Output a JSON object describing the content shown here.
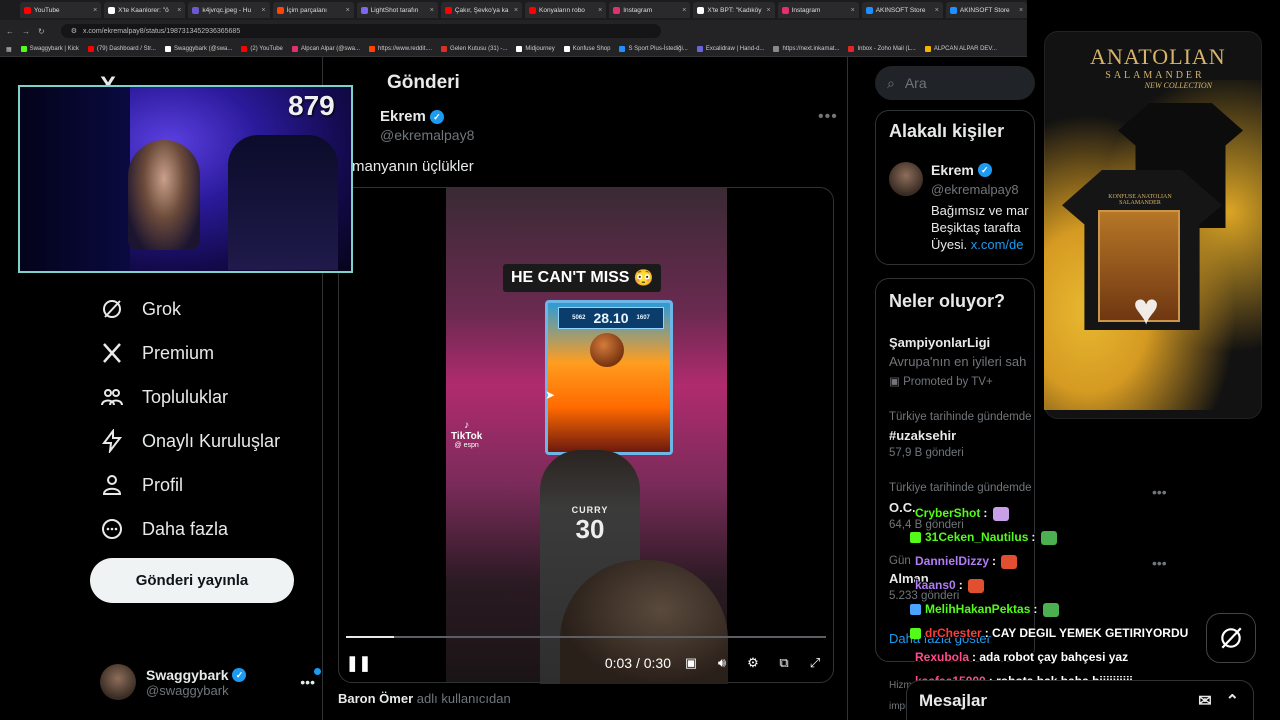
{
  "browser": {
    "tabs": [
      {
        "label": "YouTube",
        "color": "#ff0000"
      },
      {
        "label": "X'te Kaanlorer: \"ö",
        "color": "#ffffff"
      },
      {
        "label": "k4jvrqc.jpeg - Hu",
        "color": "#6a5acd"
      },
      {
        "label": "İçim parçalanı",
        "color": "#ff4500"
      },
      {
        "label": "LightShot tarafın",
        "color": "#7b68ee"
      },
      {
        "label": "Çakır, Şevko'ya ka",
        "color": "#ff0000"
      },
      {
        "label": "Konyaların robo",
        "color": "#ff0000"
      },
      {
        "label": "Instagram",
        "color": "#e1306c"
      },
      {
        "label": "X'te BPT: \"Kadıköy",
        "color": "#ffffff"
      },
      {
        "label": "Instagram",
        "color": "#e1306c"
      },
      {
        "label": "AKINSOFT Store",
        "color": "#1e90ff"
      },
      {
        "label": "AKINSOFT Store",
        "color": "#1e90ff"
      }
    ],
    "url": "x.com/ekremalpay8/status/1987313452936365685",
    "bookmarks": [
      {
        "label": "Swaggybark | Kick",
        "color": "#53fc18"
      },
      {
        "label": "(79) Dashboard / Str...",
        "color": "#ff0000"
      },
      {
        "label": "Swaggybark (@swa...",
        "color": "#ffffff"
      },
      {
        "label": "(2) YouTube",
        "color": "#ff0000"
      },
      {
        "label": "Alpcan Alpar (@swa...",
        "color": "#e1306c"
      },
      {
        "label": "https://www.reddit....",
        "color": "#ff4500"
      },
      {
        "label": "Gelen Kutusu (31) -...",
        "color": "#d93025"
      },
      {
        "label": "Midjourney",
        "color": "#ffffff"
      },
      {
        "label": "Konfuse Shop",
        "color": "#ffffff"
      },
      {
        "label": "S Sport Plus-İstediği...",
        "color": "#1e90ff"
      },
      {
        "label": "Excalidraw | Hand-d...",
        "color": "#6965db"
      },
      {
        "label": "https://next.inkamat...",
        "color": "#888888"
      },
      {
        "label": "Inbox - Zoho Mail (L...",
        "color": "#e42527"
      },
      {
        "label": "ALPCAN ALPAR DEV...",
        "color": "#f4b400"
      }
    ]
  },
  "nav": {
    "items": [
      {
        "label": "Grok",
        "icon": "grok-icon"
      },
      {
        "label": "Premium",
        "icon": "x-logo-icon"
      },
      {
        "label": "Topluluklar",
        "icon": "communities-icon"
      },
      {
        "label": "Onaylı Kuruluşlar",
        "icon": "lightning-icon"
      },
      {
        "label": "Profil",
        "icon": "person-icon"
      },
      {
        "label": "Daha fazla",
        "icon": "more-circle-icon"
      }
    ],
    "post_button": "Gönderi yayınla",
    "account": {
      "name": "Swaggybark",
      "handle": "@swaggybark"
    }
  },
  "post": {
    "header": "Gönderi",
    "author": "Ekrem",
    "handle": "@ekremalpay8",
    "text": "manyanın üçlükler",
    "video": {
      "caption": "HE CAN'T MISS",
      "caption_emoji": "😳",
      "arcade_score": "28.10",
      "arcade_left": "5062",
      "arcade_right": "1607",
      "jersey_name": "CURRY",
      "jersey_number": "30",
      "watermark": "TikTok",
      "watermark_handle": "@ espn",
      "time": "0:03 / 0:30",
      "progress": 0.1
    },
    "reply_user": "Baron Ömer",
    "reply_suffix": "adlı kullanıcıdan"
  },
  "sidebar": {
    "search_placeholder": "Ara",
    "related_title": "Alakalı kişiler",
    "related": {
      "name": "Ekrem",
      "handle": "@ekremalpay8",
      "bio_line1": "Bağımsız ve mar",
      "bio_line2": "Beşiktaş tarafta",
      "bio_line3": "Üyesi.",
      "bio_link": "x.com/de"
    },
    "whats_happening_title": "Neler oluyor?",
    "trends": [
      {
        "title": "ŞampiyonlarLigi",
        "sub": "Avrupa'nın en iyileri sah",
        "meta": "Promoted by TV+"
      },
      {
        "context": "Türkiye tarihinde gündemde",
        "title": "#uzaksehir",
        "count": "57,9 B gönderi"
      },
      {
        "context": "Türkiye tarihinde gündemde",
        "title": "O.C.",
        "count": "64,4 B gönderi"
      },
      {
        "context": "Gün",
        "title": "Alman",
        "count": "5.233 gönderi"
      }
    ],
    "show_more": "Daha fazla göster",
    "footer_1": "Hizm",
    "footer_2": "impr"
  },
  "stream": {
    "viewers": "879",
    "chat": [
      {
        "user": "CryberShot",
        "color": "#53fc18",
        "msg": "",
        "emote": "#c9a0e8",
        "badge": ""
      },
      {
        "user": "31Ceken_Nautilus",
        "color": "#53fc18",
        "msg": "",
        "emote": "#4caf50",
        "badge": "#53fc18"
      },
      {
        "user": "DannielDizzy",
        "color": "#b27cf7",
        "msg": "",
        "emote": "#e05030",
        "badge": ""
      },
      {
        "user": "kaans0",
        "color": "#b27cf7",
        "msg": "",
        "emote": "#e05030",
        "badge": ""
      },
      {
        "user": "MelihHakanPektas",
        "color": "#53fc18",
        "msg": "",
        "emote": "#4caf50",
        "badge": "#4aa3ff"
      },
      {
        "user": "drChester",
        "color": "#ff3b3b",
        "msg": "CAY DEGIL YEMEK GETIRIYORDU",
        "emote": "",
        "badge": "#53fc18"
      },
      {
        "user": "Rexubola",
        "color": "#ff4d8a",
        "msg": "ada robot çay bahçesi yaz",
        "emote": "",
        "badge": ""
      },
      {
        "user": "kaafaa15000",
        "color": "#ff4d8a",
        "msg": "robota bak baba biiiiiiiiii",
        "emote": "",
        "badge": ""
      }
    ],
    "messages_label": "Mesajlar"
  },
  "ad": {
    "brand_line1": "ANATOLIAN",
    "brand_line2": "SALAMANDER",
    "brand_line3": "NEW COLLECTION",
    "print_text": "KONFUSE ANATOLIAN SALAMANDER"
  }
}
